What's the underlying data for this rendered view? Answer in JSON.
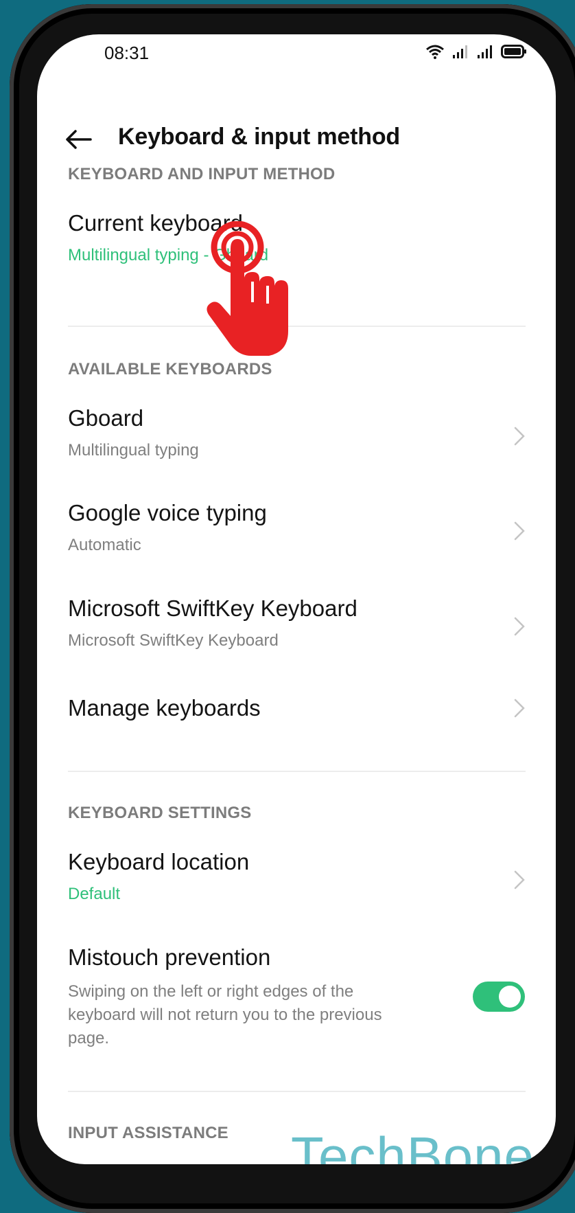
{
  "status_bar": {
    "time": "08:31",
    "icons": [
      "wifi-icon",
      "signal-icon",
      "signal-icon",
      "battery-icon"
    ]
  },
  "header": {
    "back_icon": "back-arrow-icon",
    "title": "Keyboard & input method"
  },
  "sections": {
    "keyboard_input": "KEYBOARD AND INPUT METHOD",
    "available": "AVAILABLE KEYBOARDS",
    "settings": "KEYBOARD SETTINGS",
    "assistance": "INPUT ASSISTANCE"
  },
  "current_keyboard": {
    "title": "Current keyboard",
    "value": "Multilingual typing - Gboard"
  },
  "keyboards": [
    {
      "title": "Gboard",
      "subtitle": "Multilingual typing"
    },
    {
      "title": "Google voice typing",
      "subtitle": "Automatic"
    },
    {
      "title": "Microsoft SwiftKey Keyboard",
      "subtitle": "Microsoft SwiftKey Keyboard"
    }
  ],
  "manage_keyboards": {
    "title": "Manage keyboards"
  },
  "keyboard_location": {
    "title": "Keyboard location",
    "value": "Default"
  },
  "mistouch": {
    "title": "Mistouch prevention",
    "description": "Swiping on the left or right edges of the keyboard will not return you to the previous page.",
    "enabled": true
  },
  "overlay": {
    "tap_icon": "tap-hand-icon"
  },
  "watermark": "TechBone",
  "colors": {
    "accent": "#2fc07a",
    "background": "#0f6b7f",
    "tap_icon": "#e82224",
    "watermark": "#69bfca"
  }
}
